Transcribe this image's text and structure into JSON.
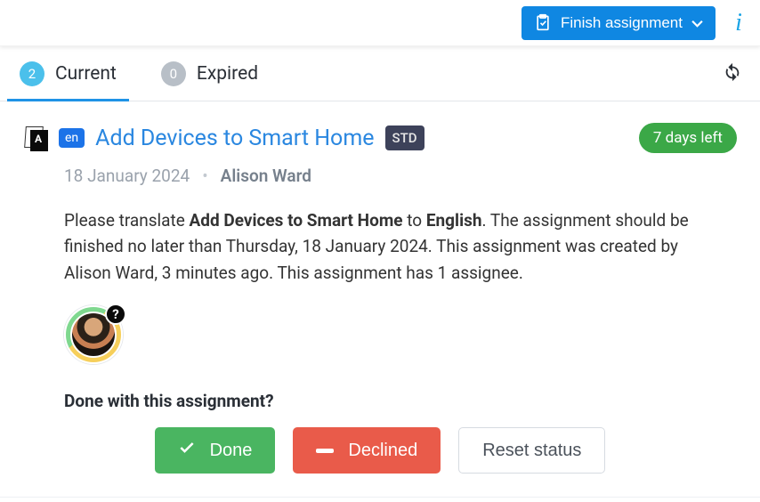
{
  "header": {
    "finish_label": "Finish assignment"
  },
  "tabs": {
    "current": {
      "count": "2",
      "label": "Current"
    },
    "expired": {
      "count": "0",
      "label": "Expired"
    }
  },
  "card": {
    "lang": "en",
    "title": "Add Devices to Smart Home",
    "std": "STD",
    "days_left": "7 days left",
    "date": "18 January 2024",
    "author": "Alison Ward",
    "desc_prefix": "Please translate ",
    "desc_title": "Add Devices to Smart Home",
    "desc_mid": " to ",
    "desc_lang": "English",
    "desc_rest": ". The assignment should be finished no later than Thursday, 18 January 2024. This assignment was created by Alison Ward, 3 minutes ago. This assignment has 1 assignee.",
    "avatar_q": "?",
    "done_question": "Done with this assignment?"
  },
  "actions": {
    "done": "Done",
    "declined": "Declined",
    "reset": "Reset status"
  }
}
